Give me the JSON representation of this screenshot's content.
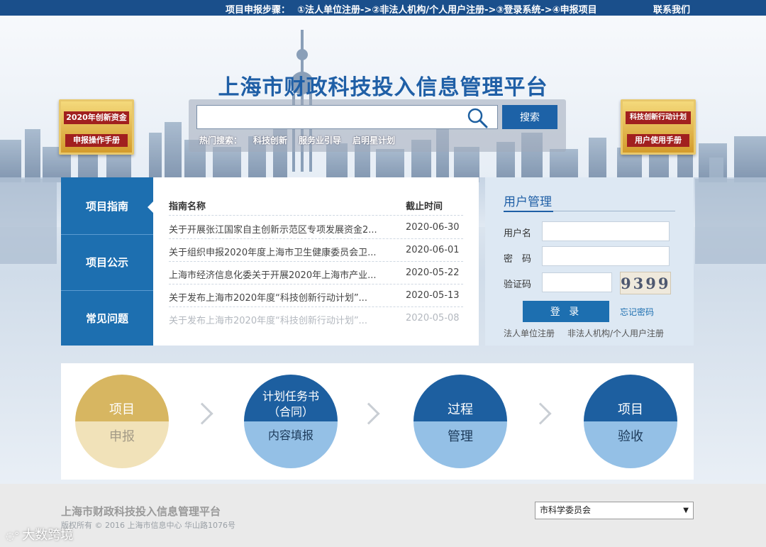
{
  "topbar": {
    "steps_label": "项目申报步骤：",
    "step1": "①法人单位注册->",
    "step2": "②非法人机构/个人用户注册->",
    "step3": "③登录系统->",
    "step4": "④申报项目",
    "contact": "联系我们"
  },
  "site_title": "上海市财政科技投入信息管理平台",
  "search": {
    "value": "",
    "button": "搜索",
    "hot_label": "热门搜索：",
    "hot_keywords": [
      "科技创新",
      "服务业引导",
      "启明星计划"
    ]
  },
  "badges": {
    "left": {
      "line1": "2020年创新资金",
      "line2": "申报操作手册"
    },
    "right": {
      "line1": "科技创新行动计划",
      "line2": "用户使用手册"
    }
  },
  "tabs": [
    "项目指南",
    "项目公示",
    "常见问题"
  ],
  "guide": {
    "col_name": "指南名称",
    "col_date": "截止时间",
    "rows": [
      {
        "title": "关于开展张江国家自主创新示范区专项发展资金2...",
        "date": "2020-06-30"
      },
      {
        "title": "关于组织申报2020年度上海市卫生健康委员会卫...",
        "date": "2020-06-01"
      },
      {
        "title": "上海市经济信息化委关于开展2020年上海市产业...",
        "date": "2020-05-22"
      },
      {
        "title": "关于发布上海市2020年度“科技创新行动计划”...",
        "date": "2020-05-13"
      },
      {
        "title": "关于发布上海市2020年度“科技创新行动计划”...",
        "date": "2020-05-08"
      }
    ]
  },
  "user": {
    "title": "用户管理",
    "username_label": "用户名",
    "password_label": "密　码",
    "captcha_label": "验证码",
    "captcha_text": "9399",
    "login": "登 录",
    "forgot": "忘记密码",
    "reg_legal": "法人单位注册",
    "reg_individual": "非法人机构/个人用户注册"
  },
  "process": [
    {
      "top": "项目",
      "bottom": "申报",
      "style": "gold"
    },
    {
      "top": "计划任务书\n（合同）",
      "bottom": "内容填报",
      "style": "blue"
    },
    {
      "top": "过程",
      "bottom": "管理",
      "style": "blue"
    },
    {
      "top": "项目",
      "bottom": "验收",
      "style": "blue"
    }
  ],
  "footer": {
    "title": "上海市财政科技投入信息管理平台",
    "copyright": "版权所有 © 2016 上海市信息中心 华山路1076号",
    "select_value": "市科学委员会"
  },
  "watermark": "大数跨境",
  "colors": {
    "primary": "#1d6fb0",
    "topbar": "#1a4f8b",
    "gold": "#d7b661"
  }
}
